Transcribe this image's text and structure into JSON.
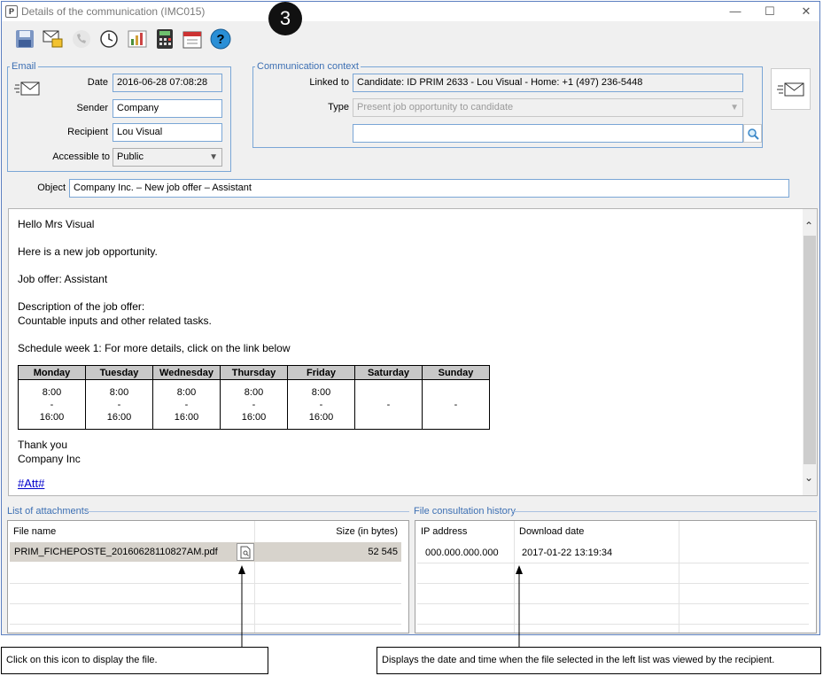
{
  "window": {
    "title": "Details of the communication (IMC015)",
    "app_icon_text": "P",
    "minimize": "—",
    "maximize": "☐",
    "close": "✕"
  },
  "step_badge": "3",
  "toolbar": {
    "icons": [
      "save-icon",
      "email-preview-icon",
      "phone-icon",
      "history-clock-icon",
      "statistics-chart-icon",
      "calculator-icon",
      "calendar-icon",
      "help-icon"
    ]
  },
  "email": {
    "legend": "Email",
    "date_label": "Date",
    "date_value": "2016-06-28 07:08:28",
    "sender_label": "Sender",
    "sender_value": "Company",
    "recipient_label": "Recipient",
    "recipient_value": "Lou Visual",
    "accessible_label": "Accessible to",
    "accessible_value": "Public"
  },
  "context": {
    "legend": "Communication context",
    "linked_label": "Linked to",
    "linked_value": "Candidate: ID PRIM 2633 - Lou Visual - Home: +1 (497) 236-5448",
    "type_label": "Type",
    "type_value": "Present job opportunity to candidate",
    "extra_value": ""
  },
  "object": {
    "label": "Object",
    "value": "Company Inc. – New job offer – Assistant"
  },
  "message": {
    "greeting": "Hello Mrs Visual",
    "line1": "Here is a new job opportunity.",
    "line2": "Job offer: Assistant",
    "line3": "Description of the job offer:",
    "line4": "Countable inputs and other related tasks.",
    "line5": "Schedule week 1: For more details, click on the link below",
    "schedule": {
      "days": [
        "Monday",
        "Tuesday",
        "Wednesday",
        "Thursday",
        "Friday",
        "Saturday",
        "Sunday"
      ],
      "cells": [
        [
          "8:00",
          "-",
          "16:00"
        ],
        [
          "8:00",
          "-",
          "16:00"
        ],
        [
          "8:00",
          "-",
          "16:00"
        ],
        [
          "8:00",
          "-",
          "16:00"
        ],
        [
          "8:00",
          "-",
          "16:00"
        ],
        [
          "-"
        ],
        [
          "-"
        ]
      ]
    },
    "thanks": "Thank you",
    "signature": "Company Inc",
    "link": "#Att#"
  },
  "attachments": {
    "legend": "List of attachments",
    "col_file": "File name",
    "col_size": "Size (in bytes)",
    "rows": [
      {
        "name": "PRIM_FICHEPOSTE_20160628110827AM.pdf",
        "size": "52 545"
      }
    ]
  },
  "history": {
    "legend": "File consultation history",
    "col_ip": "IP address",
    "col_date": "Download date",
    "rows": [
      {
        "ip": "000.000.000.000",
        "date": "2017-01-22 13:19:34"
      }
    ]
  },
  "callouts": {
    "left": "Click on this icon to display the file.",
    "right": "Displays the date and time when the file selected in the left list was viewed by the recipient."
  }
}
